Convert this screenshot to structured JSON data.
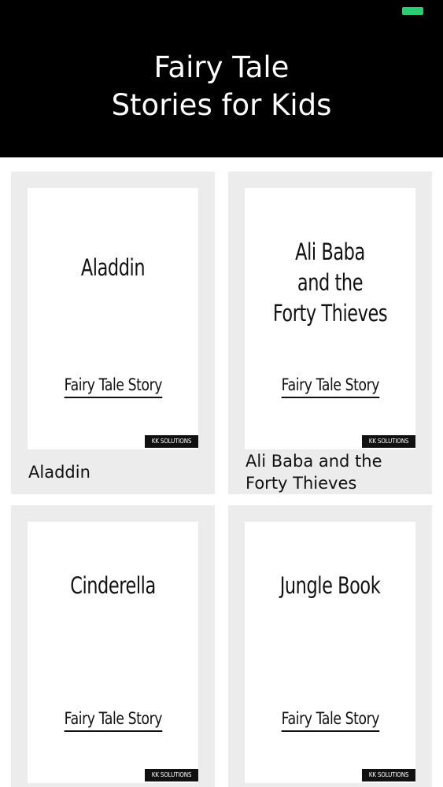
{
  "colors": {
    "header_bg": "#000000",
    "battery": "#2ecc71",
    "card_bg": "#ececec",
    "cover_bg": "#ffffff",
    "text": "#111111"
  },
  "status_bar": {
    "battery_icon": "battery-icon"
  },
  "header": {
    "title_line1": "Fairy Tale",
    "title_line2": "Stories for Kids"
  },
  "stories": [
    {
      "cover_title_lines": [
        "Aladdin"
      ],
      "cover_subtitle": "Fairy Tale Story",
      "badge": "KK SOLUTIONS",
      "label": "Aladdin"
    },
    {
      "cover_title_lines": [
        "Ali Baba",
        "and the",
        "Forty Thieves"
      ],
      "cover_subtitle": "Fairy Tale Story",
      "badge": "KK SOLUTIONS",
      "label": "Ali Baba and the Forty Thieves"
    },
    {
      "cover_title_lines": [
        "Cinderella"
      ],
      "cover_subtitle": "Fairy Tale Story",
      "badge": "KK SOLUTIONS",
      "label": ""
    },
    {
      "cover_title_lines": [
        "Jungle Book"
      ],
      "cover_subtitle": "Fairy Tale Story",
      "badge": "KK SOLUTIONS",
      "label": ""
    }
  ]
}
